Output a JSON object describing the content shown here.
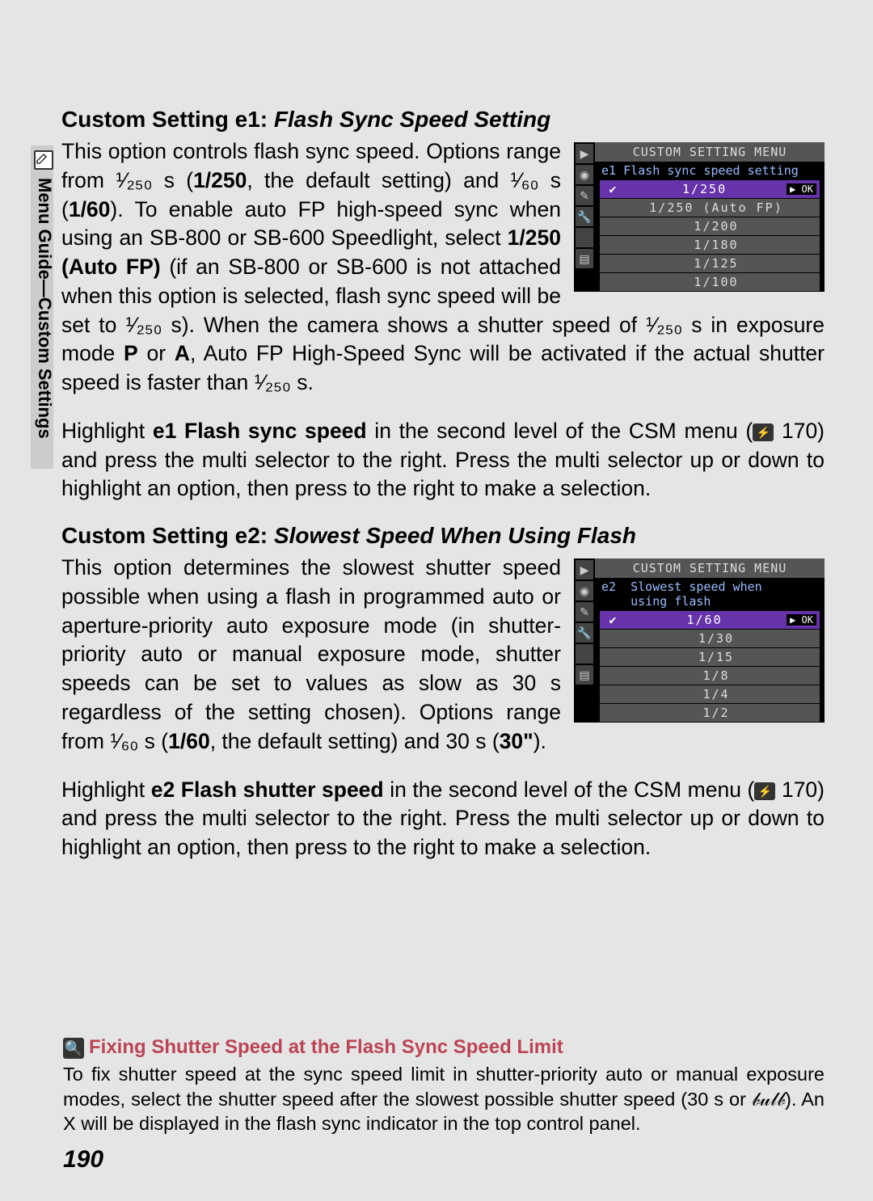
{
  "sidebar": {
    "label": "Menu Guide—Custom Settings"
  },
  "e1": {
    "heading_prefix": "Custom Setting e1: ",
    "heading_italic": "Flash Sync Speed Setting",
    "para1a": "This option controls flash sync speed.  Options range from ¹⁄₂₅₀ s (",
    "para1b": "1/250",
    "para1c": ", the default setting) and ¹⁄₆₀ s (",
    "para1d": "1/60",
    "para1e": ").  To enable auto FP high-speed sync when using an SB-800 or SB-600 Speedlight, select ",
    "para1f": "1/250 (Auto FP)",
    "para1g": " (if an SB-800 or SB-600 is not attached when this option is selected, flash sync speed will be set to ¹⁄₂₅₀ s).  When the camera shows a shutter speed of ¹⁄₂₅₀ s in exposure mode ",
    "para1h": "P",
    "para1i": " or ",
    "para1j": "A",
    "para1k": ", Auto FP High-Speed Sync will be activated if the actual shutter speed is faster than ¹⁄₂₅₀ s.",
    "para2a": "Highlight ",
    "para2b": "e1 Flash sync speed",
    "para2c": " in the second level of the CSM menu (",
    "para2d": " 170) and press the multi selector to the right.  Press the multi selector up or down to highlight an option, then press to the right to make a selection.",
    "menu": {
      "title": "CUSTOM SETTING MENU",
      "sub": "e1  Flash sync speed setting",
      "rows": [
        {
          "chk": "✔",
          "val": "1/250",
          "ok": "▶ OK"
        },
        {
          "chk": "",
          "val": "1/250 (Auto FP)",
          "ok": ""
        },
        {
          "chk": "",
          "val": "1/200",
          "ok": ""
        },
        {
          "chk": "",
          "val": "1/180",
          "ok": ""
        },
        {
          "chk": "",
          "val": "1/125",
          "ok": ""
        },
        {
          "chk": "",
          "val": "1/100",
          "ok": ""
        }
      ]
    }
  },
  "e2": {
    "heading_prefix": "Custom Setting e2: ",
    "heading_italic": "Slowest Speed When Using Flash",
    "para1a": "This option determines the slowest shutter speed possible when using a flash in programmed auto or aperture-priority auto exposure mode (in shutter-priority auto or manual exposure mode, shutter speeds can be set to values as slow as 30 s regardless of the setting chosen).  Options range from ¹⁄₆₀ s (",
    "para1b": "1/60",
    "para1c": ", the default setting) and 30 s (",
    "para1d": "30\"",
    "para1e": ").",
    "para2a": "Highlight ",
    "para2b": "e2 Flash shutter speed",
    "para2c": " in the second level of the CSM menu (",
    "para2d": " 170) and press the multi selector to the right.  Press the multi selector up or down to highlight an option, then press to the right to make a selection.",
    "menu": {
      "title": "CUSTOM SETTING MENU",
      "sub": "e2  Slowest speed when\n    using flash",
      "rows": [
        {
          "chk": "✔",
          "val": "1/60",
          "ok": "▶ OK"
        },
        {
          "chk": "",
          "val": "1/30",
          "ok": ""
        },
        {
          "chk": "",
          "val": "1/15",
          "ok": ""
        },
        {
          "chk": "",
          "val": "1/8",
          "ok": ""
        },
        {
          "chk": "",
          "val": "1/4",
          "ok": ""
        },
        {
          "chk": "",
          "val": "1/2",
          "ok": ""
        }
      ]
    }
  },
  "note": {
    "heading": "Fixing Shutter Speed at the Flash Sync Speed Limit",
    "text": "To fix shutter speed at the sync speed limit in shutter-priority auto or manual exposure modes, select the shutter speed after the slowest possible shutter speed (30 s or 𝒷𝓊𝓁𝒷).  An X will be displayed in the flash sync indicator in the top control panel."
  },
  "page_number": "190"
}
